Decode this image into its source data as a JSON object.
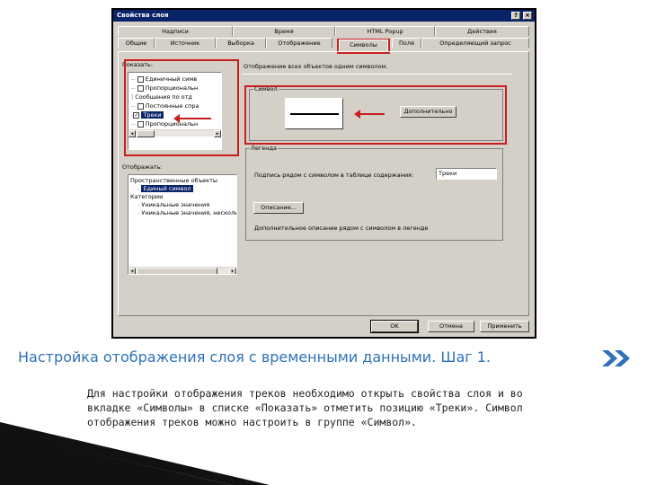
{
  "dialog": {
    "title": "Свойства слоя",
    "help_btn": "?",
    "close_btn": "×",
    "tabs_row1": [
      "Надписи",
      "Время",
      "HTML Popup",
      "Действия"
    ],
    "tabs_row2": [
      "Общие",
      "Источник",
      "Выборка",
      "Отображение",
      "Символы",
      "Поля",
      "Определяющий запрос"
    ],
    "active_tab": "Символы",
    "show_label": "Показать:",
    "show_tree": [
      {
        "label": "Единичный симв",
        "checked": false
      },
      {
        "label": "Пропорциональн",
        "checked": false
      },
      {
        "label": "Сообщения по отд",
        "checked": false
      },
      {
        "label": "Постоянные спра",
        "checked": false
      },
      {
        "label": "Треки",
        "checked": true,
        "selected": true
      },
      {
        "label": "Пропорциональн",
        "checked": false
      }
    ],
    "draw_desc": "Отображение всех объектов одним символом.",
    "symbol_group": "Символ",
    "advanced_btn": "Дополнительно",
    "legend_group": "Легенда",
    "legend_label": "Подпись рядом с символом в таблице содержания:",
    "legend_value": "Треки",
    "description_btn": "Описание...",
    "legend_desc": "Дополнительное описание рядом с символом в легенде",
    "draw_label": "Отображать:",
    "draw_tree": [
      {
        "label": "Пространственные объекты",
        "indent": 0
      },
      {
        "label": "Единый символ",
        "indent": 1,
        "selected": true
      },
      {
        "label": "Категории",
        "indent": 0
      },
      {
        "label": "Уникальные значения",
        "indent": 1
      },
      {
        "label": "Уникальные значения, несколько",
        "indent": 1
      }
    ],
    "ok_btn": "OK",
    "cancel_btn": "Отмена",
    "apply_btn": "Применить",
    "accent": "#c81e1e"
  },
  "slide": {
    "caption": "Настройка отображения слоя с временными данными. Шаг 1.",
    "body_lines": [
      "Для настройки отображения треков необходимо открыть свойства слоя и во",
      "вкладке «Символы» в списке «Показать» отметить позицию «Треки». Символ",
      "отображения треков можно настроить в группе «Символ»."
    ],
    "caption_color": "#2e72b8",
    "chevron_color": "#2e72b8"
  }
}
